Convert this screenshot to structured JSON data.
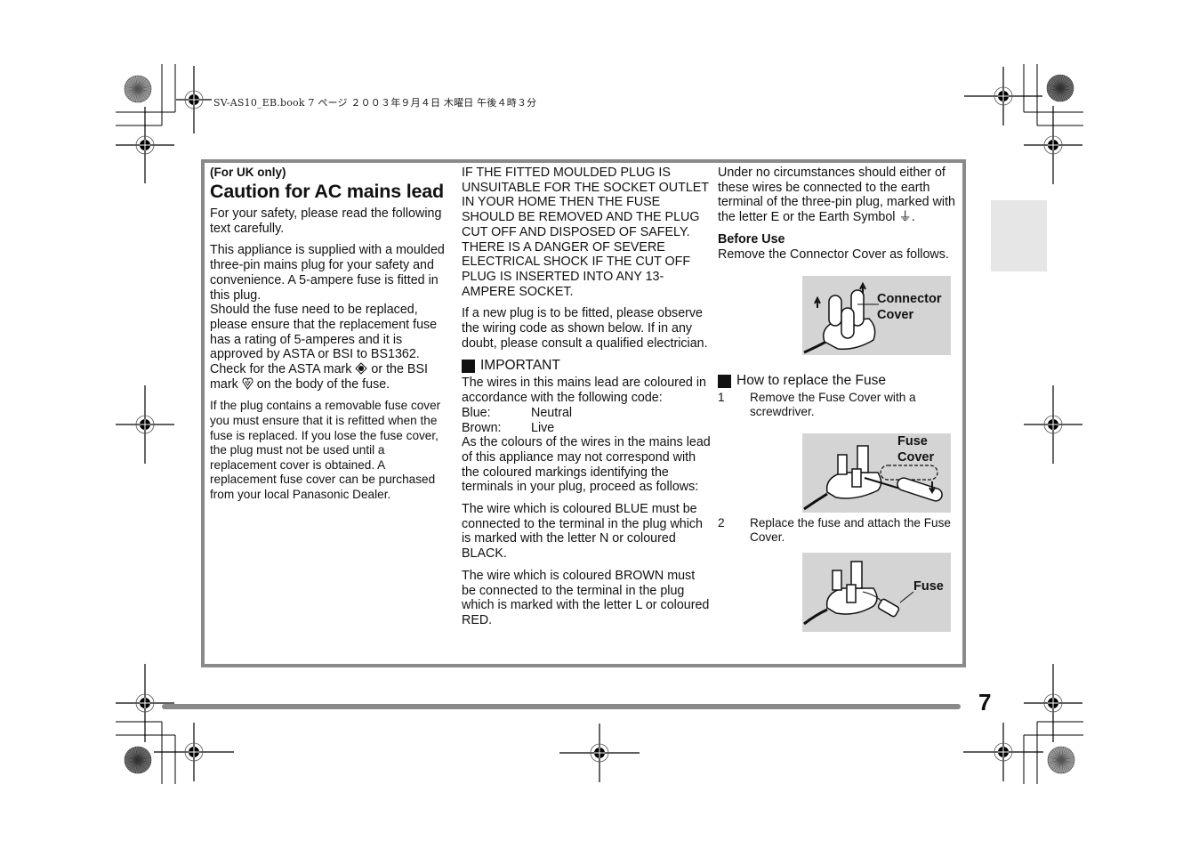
{
  "header": {
    "print_info": "SV-AS10_EB.book  7 ページ  ２００３年９月４日  木曜日  午後４時３分"
  },
  "column1": {
    "region_note": "(For UK only)",
    "title": "Caution for AC mains lead",
    "intro": "For your safety, please read the following text carefully.",
    "para1": "This appliance is supplied with a moulded three-pin mains plug for your safety and convenience. A 5-ampere fuse is fitted in this plug.",
    "para2_a": "Should the fuse need to be replaced, please ensure that the replacement fuse has a rating of 5-amperes and it is approved by ASTA or BSI to BS1362. Check for the ASTA mark ",
    "para2_b": " or the BSI mark ",
    "para2_c": " on the body of the fuse.",
    "para3": "If the plug contains a removable fuse cover you must ensure that it is refitted when the fuse is replaced. If you lose the fuse cover, the plug must not be used until a replacement cover is obtained. A replacement fuse cover can be purchased from your local Panasonic Dealer."
  },
  "column2": {
    "warning1": "IF THE FITTED MOULDED PLUG IS UNSUITABLE FOR THE SOCKET OUTLET IN YOUR HOME THEN THE FUSE SHOULD BE REMOVED AND THE PLUG CUT OFF AND DISPOSED OF SAFELY.",
    "warning2": "THERE IS A DANGER OF SEVERE ELECTRICAL SHOCK IF THE CUT OFF PLUG IS INSERTED INTO ANY 13-AMPERE SOCKET.",
    "new_plug": "If a new plug is to be fitted, please observe the wiring code as shown below. If in any doubt, please consult a qualified electrician.",
    "important_heading": "IMPORTANT",
    "wire_intro": "The wires in this mains lead are coloured in accordance with the following code:",
    "wires": [
      {
        "colour": "Blue:",
        "meaning": "Neutral"
      },
      {
        "colour": "Brown:",
        "meaning": "Live"
      }
    ],
    "colours_note": "As the colours of the wires in the mains lead of this appliance may not correspond with the coloured markings identifying the terminals in your plug, proceed as follows:",
    "blue_rule": "The wire which is coloured BLUE must be connected to the terminal in the plug which is marked with the letter N or coloured BLACK.",
    "brown_rule": "The wire which is coloured BROWN must be connected to the terminal in the plug which is marked with the letter L or coloured RED."
  },
  "column3": {
    "earth_note": "Under no circumstances should either of these wires be connected to the earth terminal of the three-pin plug, marked with the letter E or the Earth Symbol ",
    "earth_symbol": "⏚",
    "earth_end": ".",
    "before_use_heading": "Before Use",
    "before_use_text": "Remove the Connector Cover as follows.",
    "fig1_label_line1": "Connector",
    "fig1_label_line2": "Cover",
    "fuse_heading": "How to replace the Fuse",
    "steps": [
      {
        "num": "1",
        "text": "Remove the Fuse Cover with a screwdriver."
      },
      {
        "num": "2",
        "text": "Replace the fuse and attach the Fuse Cover."
      }
    ],
    "fig2_label_line1": "Fuse",
    "fig2_label_line2": "Cover",
    "fig3_label": "Fuse"
  },
  "footer": {
    "page_number": "7"
  },
  "colors": {
    "frame": "#8a8a8a",
    "figure_bg": "#d4d4d4",
    "side_tab": "#e6e6e6"
  }
}
